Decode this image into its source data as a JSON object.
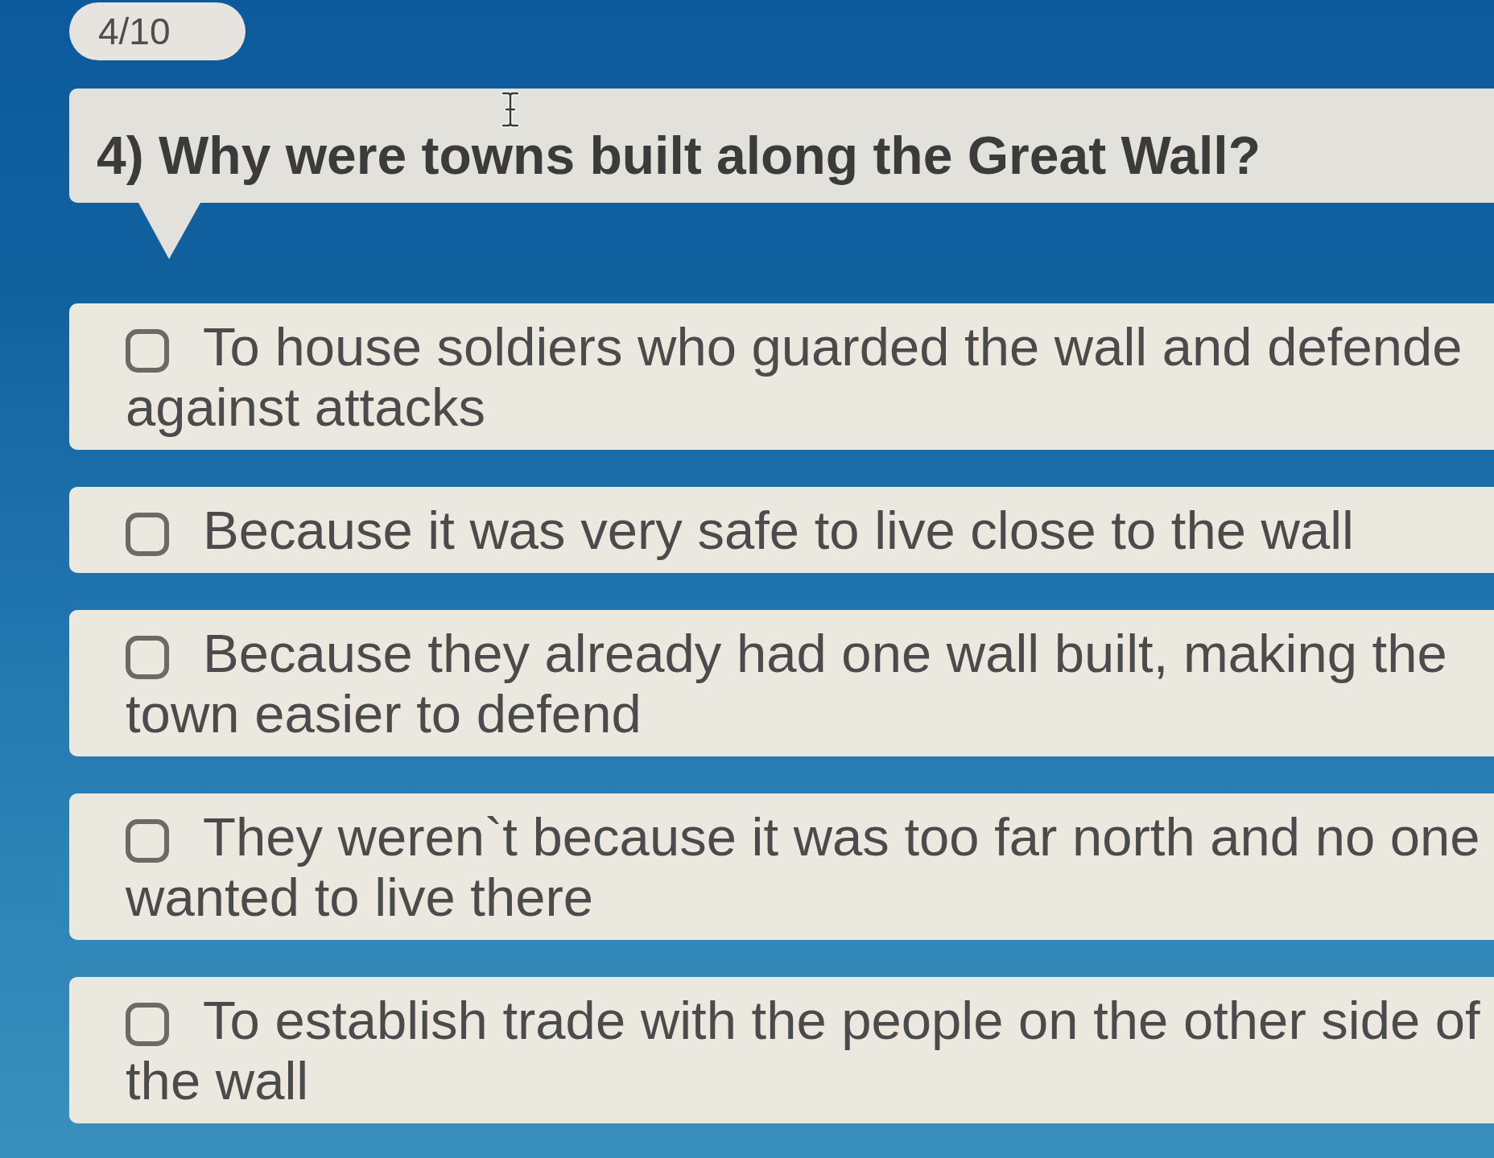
{
  "counter": {
    "text": "4/10"
  },
  "question": {
    "text": "4) Why were towns built along the Great Wall?"
  },
  "options": [
    {
      "lines": [
        "To house soldiers who guarded the wall and defende",
        "against attacks"
      ],
      "selected": false
    },
    {
      "lines": [
        "Because it was very safe to live close to the wall"
      ],
      "selected": false
    },
    {
      "lines": [
        "Because they already had one wall built, making the",
        "town easier to defend"
      ],
      "selected": false
    },
    {
      "lines": [
        "They weren`t because it was too far north and no one",
        "wanted to live there"
      ],
      "selected": false
    },
    {
      "lines": [
        "To establish trade with the people on the other side of",
        "the wall"
      ],
      "selected": false
    }
  ]
}
